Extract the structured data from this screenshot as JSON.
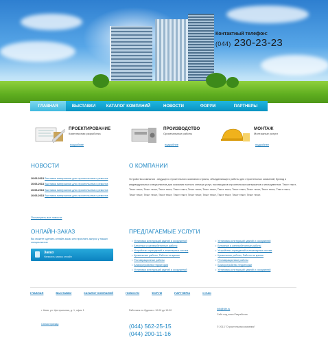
{
  "header": {
    "phone_label": "Контактный телефон:",
    "phone_code": "(044)",
    "phone_number": "230-23-23"
  },
  "nav": {
    "items": [
      {
        "label": "ГЛАВНАЯ",
        "active": true
      },
      {
        "label": "ВЫСТАВКИ",
        "active": false
      },
      {
        "label": "КАТАЛОГ КОМПАНИЙ",
        "active": false
      },
      {
        "label": "НОВОСТИ",
        "active": false
      },
      {
        "label": "ФОРУМ",
        "active": false
      },
      {
        "label": "ПАРТНЕРЫ",
        "active": false
      }
    ]
  },
  "features": [
    {
      "title": "ПРОЕКТИРОВАНИЕ",
      "desc": "Комплексная разработка",
      "more": "подробнее"
    },
    {
      "title": "ПРОИЗВОДСТВО",
      "desc": "Оригинальные работы",
      "more": "подробнее"
    },
    {
      "title": "МОНТАЖ",
      "desc": "Монтажные услуги",
      "more": "подробнее"
    }
  ],
  "news": {
    "heading": "НОВОСТИ",
    "items": [
      {
        "date": "10.06.2013",
        "text": "Выставка материалов для строительства и ремонта"
      },
      {
        "date": "10.06.2013",
        "text": "Выставка материалов для строительства и ремонта"
      },
      {
        "date": "10.06.2013",
        "text": "Выставка материалов для строительства и ремонта"
      },
      {
        "date": "10.06.2013",
        "text": "Выставка материалов для строительства и ремонта"
      }
    ],
    "all_link": "Посмотреть все новости"
  },
  "about": {
    "heading": "О КОМПАНИИ",
    "text": "Устройство компании - ведущего строительного компании страны, объединяющего работы для строительных компаний, бригад и индивидуальных специалистов для оказания полного спектра услуг, поставщиков строительных материалов и инструментов. Текст текст, Текст текст, Текст текст, Текст текст, Текст текст, Текст текст, Текст текст, Текст текст, Текст текст, Текст текст, Текст текст, Текст текст, Текст текст, Текст текст, Текст текст, Текст текст, Текст текст, Текст текст, Текст текст, Текст текст, Текст текст."
  },
  "order": {
    "heading": "ОНЛАЙН-ЗАКАЗ",
    "note": "Вы можете сделать онлайн-заказ или прислать запрос у наших специалистов",
    "button_title": "Заказ",
    "button_sub": "Написать заявку онлайн"
  },
  "services": {
    "heading": "ПРЕДЛАГАЕМЫЕ УСЛУГИ",
    "col1": [
      "Установка конструкций зданий и сооружений",
      "Бетонные и железобетонные работы",
      "Устройство ограждений и инженерных систем",
      "Кровельные работы, Работы на крыше",
      "Реставрационные работы",
      "Благоустройство территории",
      "Установка конструкций зданий и сооружений"
    ],
    "col2": [
      "Установка конструкций зданий и сооружений",
      "Бетонные и железобетонные работы",
      "Устройство ограждений и инженерных систем",
      "Кровельные работы, Работы на крыше",
      "Реставрационные работы",
      "Благоустройство территории",
      "Установка конструкций зданий и сооружений"
    ]
  },
  "footer": {
    "nav": [
      "ГЛАВНАЯ",
      "ВЫСТАВКИ",
      "КАТАЛОГ КОМПАНИЙ",
      "НОВОСТИ",
      "ФОРУМ",
      "ПАРТНЕРЫ",
      "О НАС"
    ],
    "address": "г. Киев, ул. Центральная, д. 1, офис 1",
    "map_link": "Схема проезда",
    "hours": "Работаем по будням с 10:00 до 19:00",
    "phone1": "(044) 562-25-15",
    "phone2": "(044) 200-11-16",
    "email": "info@site.ru",
    "dev": "Сайт под ключ.Разработка",
    "copyright": "© 2013 \"Строительная компания\""
  }
}
